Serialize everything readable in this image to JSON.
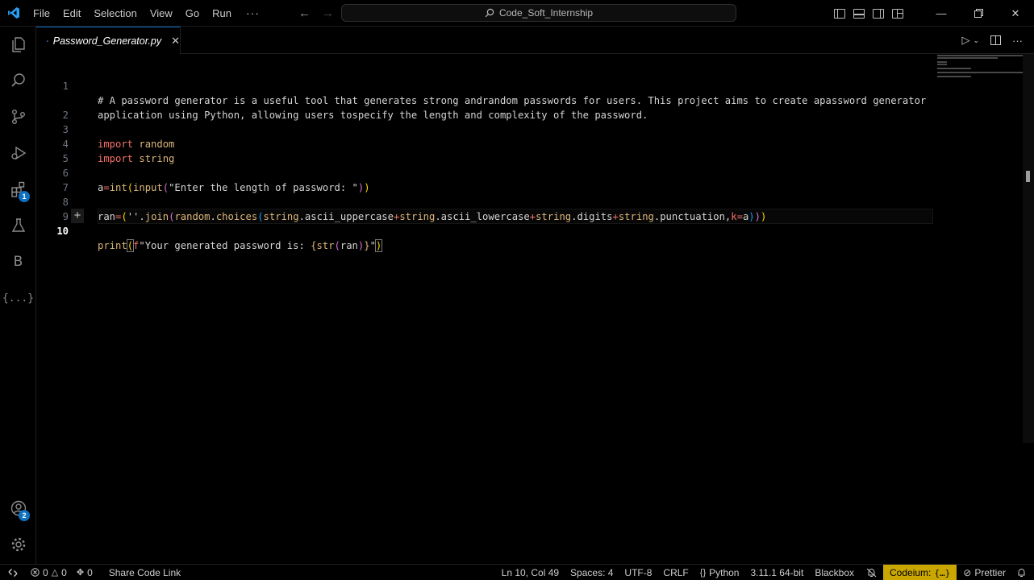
{
  "menu": [
    "File",
    "Edit",
    "Selection",
    "View",
    "Go",
    "Run"
  ],
  "menu_more": "···",
  "search_label": "Code_Soft_Internship",
  "tab": {
    "name": "Password_Generator.py"
  },
  "editor": {
    "lines": [
      {
        "num": "1",
        "text": "# A password generator is a useful tool that generates strong andrandom passwords for users. This project aims to create apassword generator"
      },
      {
        "num": "",
        "text": "application using Python, allowing users tospecify the length and complexity of the password."
      },
      {
        "num": "2",
        "text": ""
      },
      {
        "num": "3",
        "text": "import random"
      },
      {
        "num": "4",
        "text": "import string"
      },
      {
        "num": "5",
        "text": ""
      },
      {
        "num": "6",
        "text": "a=int(input(\"Enter the length of password: \"))"
      },
      {
        "num": "7",
        "text": ""
      },
      {
        "num": "8",
        "text": "ran=(''.join(random.choices(string.ascii_uppercase+string.ascii_lowercase+string.digits+string.punctuation,k=a)))"
      },
      {
        "num": "9",
        "text": ""
      },
      {
        "num": "10",
        "text": "print(f\"Your generated password is: {str(ran)}\")"
      }
    ],
    "active_line": "10"
  },
  "activity_badges": {
    "extensions": "1",
    "accounts": "2"
  },
  "activity_letter": "B",
  "activity_braces": "{...}",
  "status": {
    "errors": "0",
    "warnings": "0",
    "ports": "0",
    "share": "Share Code Link",
    "position": "Ln 10, Col 49",
    "spaces": "Spaces: 4",
    "encoding": "UTF-8",
    "eol": "CRLF",
    "language": "Python",
    "interpreter": "3.11.1 64-bit",
    "blackbox": "Blackbox",
    "codeium": "Codeium:",
    "prettier": "Prettier"
  },
  "colors": {
    "accent": "#0e70c0",
    "keyword": "#f47067",
    "function": "#dcb67a",
    "codeium_bg": "#caa700"
  }
}
